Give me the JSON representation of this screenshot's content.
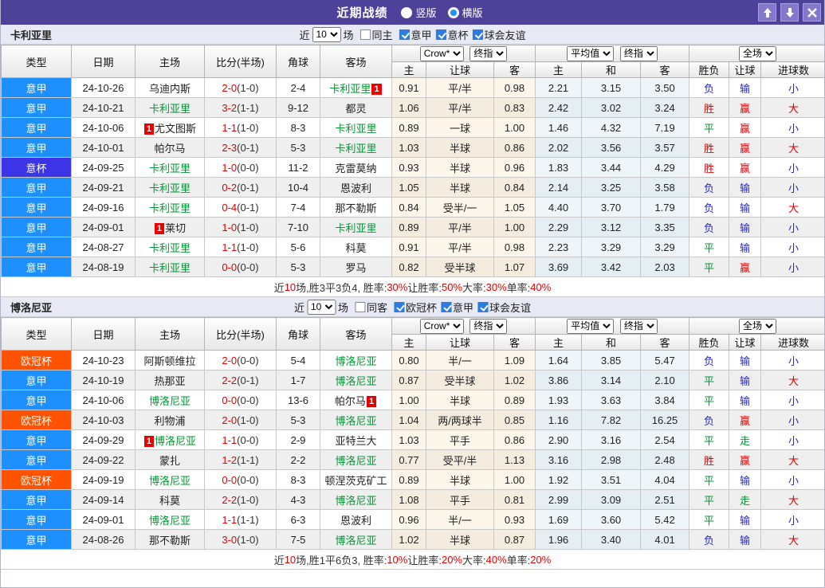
{
  "titlebar": {
    "title": "近期战绩",
    "layout_options": [
      {
        "label": "竖版",
        "selected": false
      },
      {
        "label": "横版",
        "selected": true
      }
    ],
    "icons": {
      "up": "arrow-up-icon",
      "down": "arrow-down-icon",
      "close": "close-icon"
    }
  },
  "columns": {
    "main": [
      "类型",
      "日期",
      "主场",
      "比分(半场)",
      "角球",
      "客场"
    ],
    "sub": [
      "主",
      "让球",
      "客",
      "主",
      "和",
      "客",
      "胜负",
      "让球",
      "进球数"
    ],
    "selects": {
      "bookmaker": "Crow*",
      "final": "终指",
      "average": "平均值",
      "final2": "终指",
      "scope": "全场"
    }
  },
  "colors": {
    "titlebar": "#4e4199",
    "serie_a": "#1e8fff",
    "coppa_italia": "#3c35e8",
    "champions_league": "#ff5302",
    "focus_team_green": "#009933",
    "score_red": "#e60000",
    "win_red": "#e60000",
    "draw_green": "#009933",
    "lose_blue": "#2626cc"
  },
  "sections": [
    {
      "team": "卡利亚里",
      "filter": {
        "prefix": "近",
        "count": "10",
        "suffix": "场",
        "same": {
          "label": "同主",
          "checked": false
        },
        "leagues": [
          {
            "label": "意甲",
            "checked": true
          },
          {
            "label": "意杯",
            "checked": true
          },
          {
            "label": "球会友谊",
            "checked": true
          }
        ]
      },
      "rows": [
        {
          "type": "意甲",
          "type_class": "seriea",
          "date": "24-10-26",
          "home": {
            "name": "乌迪内斯"
          },
          "ft": "2-0",
          "ht": "(1-0)",
          "corners": "2-4",
          "away": {
            "name": "卡利亚里",
            "green": true,
            "badge": "1",
            "badge_pos": "after"
          },
          "odds": [
            "0.91",
            "平/半",
            "0.98"
          ],
          "avg": [
            "2.21",
            "3.15",
            "3.50"
          ],
          "results": [
            [
              "负",
              "blue"
            ],
            [
              "输",
              "blue"
            ],
            [
              "小",
              "blue"
            ]
          ]
        },
        {
          "type": "意甲",
          "type_class": "seriea",
          "date": "24-10-21",
          "home": {
            "name": "卡利亚里",
            "green": true
          },
          "ft": "3-2",
          "ht": "(1-1)",
          "corners": "9-12",
          "away": {
            "name": "都灵"
          },
          "odds": [
            "1.06",
            "平/半",
            "0.83"
          ],
          "avg": [
            "2.42",
            "3.02",
            "3.24"
          ],
          "results": [
            [
              "胜",
              "red"
            ],
            [
              "赢",
              "red"
            ],
            [
              "大",
              "red"
            ]
          ]
        },
        {
          "type": "意甲",
          "type_class": "seriea",
          "date": "24-10-06",
          "home": {
            "name": "尤文图斯",
            "badge": "1",
            "badge_pos": "before"
          },
          "ft": "1-1",
          "ht": "(1-0)",
          "corners": "8-3",
          "away": {
            "name": "卡利亚里",
            "green": true
          },
          "odds": [
            "0.89",
            "一球",
            "1.00"
          ],
          "avg": [
            "1.46",
            "4.32",
            "7.19"
          ],
          "results": [
            [
              "平",
              "green"
            ],
            [
              "赢",
              "red"
            ],
            [
              "小",
              "blue"
            ]
          ]
        },
        {
          "type": "意甲",
          "type_class": "seriea",
          "date": "24-10-01",
          "home": {
            "name": "帕尔马"
          },
          "ft": "2-3",
          "ht": "(0-1)",
          "corners": "5-3",
          "away": {
            "name": "卡利亚里",
            "green": true
          },
          "odds": [
            "1.03",
            "半球",
            "0.86"
          ],
          "avg": [
            "2.02",
            "3.56",
            "3.57"
          ],
          "results": [
            [
              "胜",
              "red"
            ],
            [
              "赢",
              "red"
            ],
            [
              "大",
              "red"
            ]
          ]
        },
        {
          "type": "意杯",
          "type_class": "coppa",
          "date": "24-09-25",
          "home": {
            "name": "卡利亚里",
            "green": true
          },
          "ft": "1-0",
          "ht": "(0-0)",
          "corners": "11-2",
          "away": {
            "name": "克雷莫纳"
          },
          "odds": [
            "0.93",
            "半球",
            "0.96"
          ],
          "avg": [
            "1.83",
            "3.44",
            "4.29"
          ],
          "results": [
            [
              "胜",
              "red"
            ],
            [
              "赢",
              "red"
            ],
            [
              "小",
              "blue"
            ]
          ]
        },
        {
          "type": "意甲",
          "type_class": "seriea",
          "date": "24-09-21",
          "home": {
            "name": "卡利亚里",
            "green": true
          },
          "ft": "0-2",
          "ht": "(0-1)",
          "corners": "10-4",
          "away": {
            "name": "恩波利"
          },
          "odds": [
            "1.05",
            "半球",
            "0.84"
          ],
          "avg": [
            "2.14",
            "3.25",
            "3.58"
          ],
          "results": [
            [
              "负",
              "blue"
            ],
            [
              "输",
              "blue"
            ],
            [
              "小",
              "blue"
            ]
          ]
        },
        {
          "type": "意甲",
          "type_class": "seriea",
          "date": "24-09-16",
          "home": {
            "name": "卡利亚里",
            "green": true
          },
          "ft": "0-4",
          "ht": "(0-1)",
          "corners": "7-4",
          "away": {
            "name": "那不勒斯"
          },
          "odds": [
            "0.84",
            "受半/一",
            "1.05"
          ],
          "avg": [
            "4.40",
            "3.70",
            "1.79"
          ],
          "results": [
            [
              "负",
              "blue"
            ],
            [
              "输",
              "blue"
            ],
            [
              "大",
              "red"
            ]
          ]
        },
        {
          "type": "意甲",
          "type_class": "seriea",
          "date": "24-09-01",
          "home": {
            "name": "莱切",
            "badge": "1",
            "badge_pos": "before"
          },
          "ft": "1-0",
          "ht": "(1-0)",
          "corners": "7-10",
          "away": {
            "name": "卡利亚里",
            "green": true
          },
          "odds": [
            "0.89",
            "平/半",
            "1.00"
          ],
          "avg": [
            "2.29",
            "3.12",
            "3.35"
          ],
          "results": [
            [
              "负",
              "blue"
            ],
            [
              "输",
              "blue"
            ],
            [
              "小",
              "blue"
            ]
          ]
        },
        {
          "type": "意甲",
          "type_class": "seriea",
          "date": "24-08-27",
          "home": {
            "name": "卡利亚里",
            "green": true
          },
          "ft": "1-1",
          "ht": "(1-0)",
          "corners": "5-6",
          "away": {
            "name": "科莫"
          },
          "odds": [
            "0.91",
            "平/半",
            "0.98"
          ],
          "avg": [
            "2.23",
            "3.29",
            "3.29"
          ],
          "results": [
            [
              "平",
              "green"
            ],
            [
              "输",
              "blue"
            ],
            [
              "小",
              "blue"
            ]
          ]
        },
        {
          "type": "意甲",
          "type_class": "seriea",
          "date": "24-08-19",
          "home": {
            "name": "卡利亚里",
            "green": true
          },
          "ft": "0-0",
          "ht": "(0-0)",
          "corners": "5-3",
          "away": {
            "name": "罗马"
          },
          "odds": [
            "0.82",
            "受半球",
            "1.07"
          ],
          "avg": [
            "3.69",
            "3.42",
            "2.03"
          ],
          "results": [
            [
              "平",
              "green"
            ],
            [
              "赢",
              "red"
            ],
            [
              "小",
              "blue"
            ]
          ]
        }
      ],
      "summary": [
        {
          "text": "近"
        },
        {
          "text": "10",
          "red": true
        },
        {
          "text": "场,胜3平3负4, 胜率:"
        },
        {
          "text": "30%",
          "red": true
        },
        {
          "text": " 让胜率:"
        },
        {
          "text": "50%",
          "red": true
        },
        {
          "text": " 大率:"
        },
        {
          "text": "30%",
          "red": true
        },
        {
          "text": " 单率:"
        },
        {
          "text": "40%",
          "red": true
        }
      ]
    },
    {
      "team": "博洛尼亚",
      "filter": {
        "prefix": "近",
        "count": "10",
        "suffix": "场",
        "same": {
          "label": "同客",
          "checked": false
        },
        "leagues": [
          {
            "label": "欧冠杯",
            "checked": true
          },
          {
            "label": "意甲",
            "checked": true
          },
          {
            "label": "球会友谊",
            "checked": true
          }
        ]
      },
      "rows": [
        {
          "type": "欧冠杯",
          "type_class": "ucl",
          "date": "24-10-23",
          "home": {
            "name": "阿斯顿维拉"
          },
          "ft": "2-0",
          "ht": "(0-0)",
          "corners": "5-4",
          "away": {
            "name": "博洛尼亚",
            "green": true
          },
          "odds": [
            "0.80",
            "半/一",
            "1.09"
          ],
          "avg": [
            "1.64",
            "3.85",
            "5.47"
          ],
          "results": [
            [
              "负",
              "blue"
            ],
            [
              "输",
              "blue"
            ],
            [
              "小",
              "blue"
            ]
          ]
        },
        {
          "type": "意甲",
          "type_class": "seriea",
          "date": "24-10-19",
          "home": {
            "name": "热那亚"
          },
          "ft": "2-2",
          "ht": "(0-1)",
          "corners": "1-7",
          "away": {
            "name": "博洛尼亚",
            "green": true
          },
          "odds": [
            "0.87",
            "受半球",
            "1.02"
          ],
          "avg": [
            "3.86",
            "3.14",
            "2.10"
          ],
          "results": [
            [
              "平",
              "green"
            ],
            [
              "输",
              "blue"
            ],
            [
              "大",
              "red"
            ]
          ]
        },
        {
          "type": "意甲",
          "type_class": "seriea",
          "date": "24-10-06",
          "home": {
            "name": "博洛尼亚",
            "green": true
          },
          "ft": "0-0",
          "ht": "(0-0)",
          "corners": "13-6",
          "away": {
            "name": "帕尔马",
            "badge": "1",
            "badge_pos": "after"
          },
          "odds": [
            "1.00",
            "半球",
            "0.89"
          ],
          "avg": [
            "1.93",
            "3.63",
            "3.84"
          ],
          "results": [
            [
              "平",
              "green"
            ],
            [
              "输",
              "blue"
            ],
            [
              "小",
              "blue"
            ]
          ]
        },
        {
          "type": "欧冠杯",
          "type_class": "ucl",
          "date": "24-10-03",
          "home": {
            "name": "利物浦"
          },
          "ft": "2-0",
          "ht": "(1-0)",
          "corners": "5-3",
          "away": {
            "name": "博洛尼亚",
            "green": true
          },
          "odds": [
            "1.04",
            "两/两球半",
            "0.85"
          ],
          "avg": [
            "1.16",
            "7.82",
            "16.25"
          ],
          "results": [
            [
              "负",
              "blue"
            ],
            [
              "赢",
              "red"
            ],
            [
              "小",
              "blue"
            ]
          ]
        },
        {
          "type": "意甲",
          "type_class": "seriea",
          "date": "24-09-29",
          "home": {
            "name": "博洛尼亚",
            "green": true,
            "badge": "1",
            "badge_pos": "before"
          },
          "ft": "1-1",
          "ht": "(0-0)",
          "corners": "2-9",
          "away": {
            "name": "亚特兰大"
          },
          "odds": [
            "1.03",
            "平手",
            "0.86"
          ],
          "avg": [
            "2.90",
            "3.16",
            "2.54"
          ],
          "results": [
            [
              "平",
              "green"
            ],
            [
              "走",
              "green"
            ],
            [
              "小",
              "blue"
            ]
          ]
        },
        {
          "type": "意甲",
          "type_class": "seriea",
          "date": "24-09-22",
          "home": {
            "name": "蒙扎"
          },
          "ft": "1-2",
          "ht": "(1-1)",
          "corners": "2-2",
          "away": {
            "name": "博洛尼亚",
            "green": true
          },
          "odds": [
            "0.77",
            "受平/半",
            "1.13"
          ],
          "avg": [
            "3.16",
            "2.98",
            "2.48"
          ],
          "results": [
            [
              "胜",
              "red"
            ],
            [
              "赢",
              "red"
            ],
            [
              "大",
              "red"
            ]
          ]
        },
        {
          "type": "欧冠杯",
          "type_class": "ucl",
          "date": "24-09-19",
          "home": {
            "name": "博洛尼亚",
            "green": true
          },
          "ft": "0-0",
          "ht": "(0-0)",
          "corners": "8-3",
          "away": {
            "name": "顿涅茨克矿工"
          },
          "odds": [
            "0.89",
            "半球",
            "1.00"
          ],
          "avg": [
            "1.92",
            "3.51",
            "4.04"
          ],
          "results": [
            [
              "平",
              "green"
            ],
            [
              "输",
              "blue"
            ],
            [
              "小",
              "blue"
            ]
          ]
        },
        {
          "type": "意甲",
          "type_class": "seriea",
          "date": "24-09-14",
          "home": {
            "name": "科莫"
          },
          "ft": "2-2",
          "ht": "(1-0)",
          "corners": "4-3",
          "away": {
            "name": "博洛尼亚",
            "green": true
          },
          "odds": [
            "1.08",
            "平手",
            "0.81"
          ],
          "avg": [
            "2.99",
            "3.09",
            "2.51"
          ],
          "results": [
            [
              "平",
              "green"
            ],
            [
              "走",
              "green"
            ],
            [
              "大",
              "red"
            ]
          ]
        },
        {
          "type": "意甲",
          "type_class": "seriea",
          "date": "24-09-01",
          "home": {
            "name": "博洛尼亚",
            "green": true
          },
          "ft": "1-1",
          "ht": "(1-1)",
          "corners": "6-3",
          "away": {
            "name": "恩波利"
          },
          "odds": [
            "0.96",
            "半/一",
            "0.93"
          ],
          "avg": [
            "1.69",
            "3.60",
            "5.42"
          ],
          "results": [
            [
              "平",
              "green"
            ],
            [
              "输",
              "blue"
            ],
            [
              "小",
              "blue"
            ]
          ]
        },
        {
          "type": "意甲",
          "type_class": "seriea",
          "date": "24-08-26",
          "home": {
            "name": "那不勒斯"
          },
          "ft": "3-0",
          "ht": "(1-0)",
          "corners": "7-5",
          "away": {
            "name": "博洛尼亚",
            "green": true
          },
          "odds": [
            "1.02",
            "半球",
            "0.87"
          ],
          "avg": [
            "1.96",
            "3.40",
            "4.01"
          ],
          "results": [
            [
              "负",
              "blue"
            ],
            [
              "输",
              "blue"
            ],
            [
              "大",
              "red"
            ]
          ]
        }
      ],
      "summary": [
        {
          "text": "近"
        },
        {
          "text": "10",
          "red": true
        },
        {
          "text": "场,胜1平6负3, 胜率:"
        },
        {
          "text": "10%",
          "red": true
        },
        {
          "text": " 让胜率:"
        },
        {
          "text": "20%",
          "red": true
        },
        {
          "text": " 大率:"
        },
        {
          "text": "40%",
          "red": true
        },
        {
          "text": " 单率:"
        },
        {
          "text": "20%",
          "red": true
        }
      ]
    }
  ]
}
